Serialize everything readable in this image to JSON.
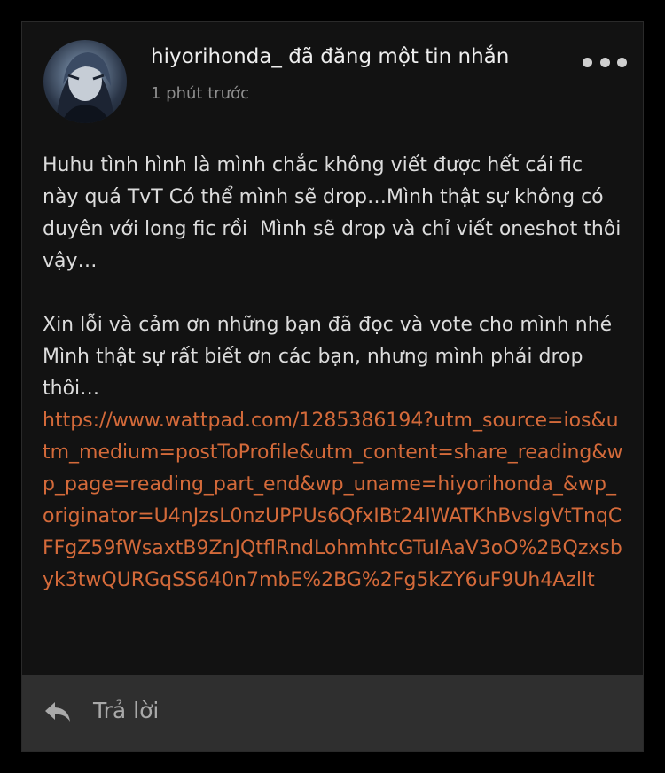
{
  "post": {
    "author": "hiyorihonda_",
    "action": " đã đăng một tin nhắn",
    "timestamp": "1 phút trước",
    "more_icon": "more-horizontal-icon",
    "avatar_icon": "user-avatar"
  },
  "message": {
    "paragraph_1": "Huhu tình hình là mình chắc không viết được hết cái fic này quá TvT Có thể mình sẽ drop…Mình thật sự không có duyên với long fic rồi  Mình sẽ drop và chỉ viết oneshot thôi vậy…",
    "paragraph_2": "Xin lỗi và cảm ơn những bạn đã đọc và vote cho mình nhé  Mình thật sự rất biết ơn các bạn, nhưng mình phải drop thôi…",
    "link": "https://www.wattpad.com/1285386194?utm_source=ios&utm_medium=postToProfile&utm_content=share_reading&wp_page=reading_part_end&wp_uname=hiyorihonda_&wp_originator=U4nJzsL0nzUPPUs6QfxIBt24lWATKhBvslgVtTnqCFFgZ59fWsaxtB9ZnJQtflRndLohmhtcGTuIAaV3oO%2BQzxsbyk3twQURGqSS640n7mbE%2BG%2Fg5kZY6uF9Uh4Azllt"
  },
  "reply": {
    "label": "Trả lời",
    "icon": "reply-arrow-icon"
  },
  "colors": {
    "background": "#000000",
    "card": "#121212",
    "link": "#d46a3a",
    "reply_bar": "#2f2f2f"
  }
}
